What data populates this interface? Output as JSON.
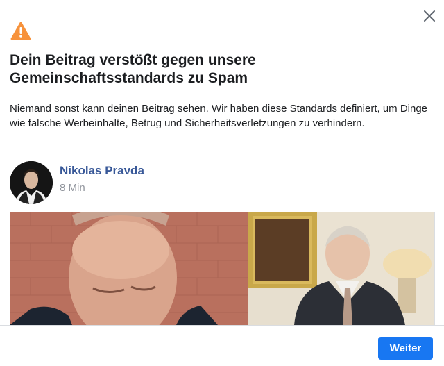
{
  "dialog": {
    "close_icon": "close-icon",
    "warning_icon": "warning-icon",
    "warning_color": "#f7923b",
    "title": "Dein Beitrag verstößt gegen unsere Gemeinschaftsstandards zu Spam",
    "description": "Niemand sonst kann deinen Beitrag sehen. Wir haben diese Standards definiert, um Dinge wie falsche Werbeinhalte, Betrug und Sicherheitsverletzungen zu verhindern.",
    "continue_label": "Weiter",
    "accent_color": "#1877f2"
  },
  "post": {
    "author": "Nikolas Pravda",
    "author_color": "#385898",
    "time": "8 Min"
  }
}
